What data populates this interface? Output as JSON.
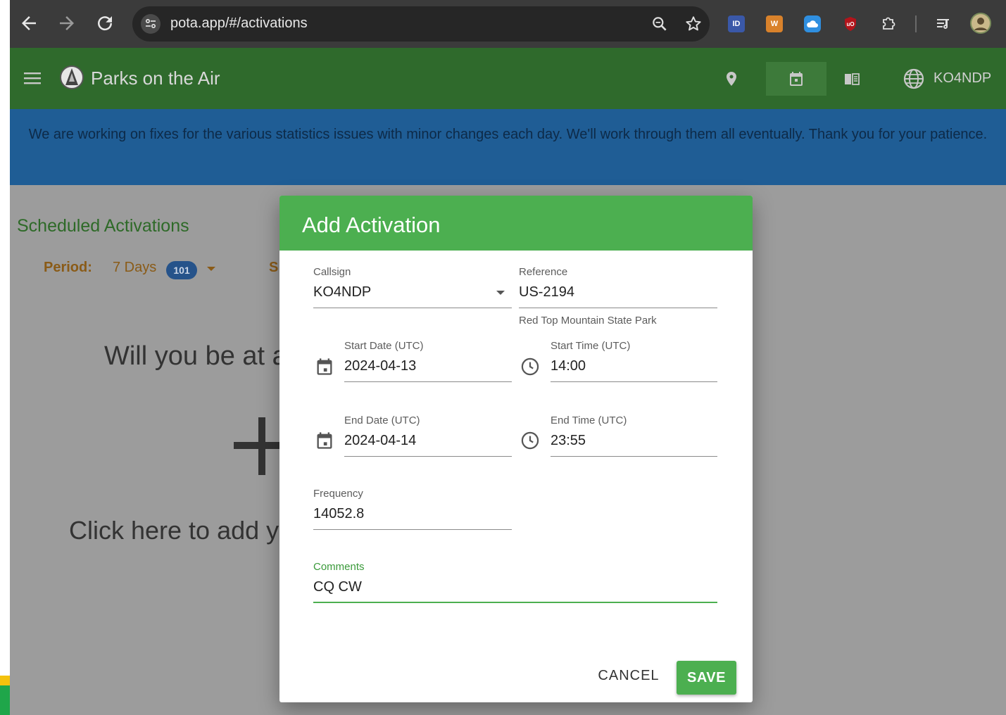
{
  "browser": {
    "url": "pota.app/#/activations"
  },
  "app": {
    "title": "Parks on the Air",
    "user": "KO4NDP"
  },
  "banner": {
    "text": "We are working on fixes for the various statistics issues with minor changes each day. We'll work through them all eventually. Thank you for your patience."
  },
  "page": {
    "section_title": "Scheduled Activations",
    "period_label": "Period:",
    "period_value": "7 Days",
    "period_count": "101",
    "partial_filter_letter": "S",
    "prompt_partial": "Will you be at a",
    "add_prompt_partial": "Click here to add y"
  },
  "dialog": {
    "title": "Add Activation",
    "callsign": {
      "label": "Callsign",
      "value": "KO4NDP"
    },
    "reference": {
      "label": "Reference",
      "value": "US-2194",
      "hint": "Red Top Mountain State Park"
    },
    "start_date": {
      "label": "Start Date (UTC)",
      "value": "2024-04-13"
    },
    "start_time": {
      "label": "Start Time (UTC)",
      "value": "14:00"
    },
    "end_date": {
      "label": "End Date (UTC)",
      "value": "2024-04-14"
    },
    "end_time": {
      "label": "End Time (UTC)",
      "value": "23:55"
    },
    "frequency": {
      "label": "Frequency",
      "value": "14052.8"
    },
    "comments": {
      "label": "Comments",
      "value": "CQ CW"
    },
    "cancel_label": "CANCEL",
    "save_label": "SAVE"
  },
  "colors": {
    "appbar": "#2f6a2c",
    "banner": "#1f5d95",
    "dialog_header": "#4caf50",
    "save_button": "#4caf50",
    "focus_line": "#4caf50"
  },
  "icons": {
    "nav": [
      "back-arrow-icon",
      "forward-arrow-icon",
      "reload-icon"
    ],
    "url": [
      "site-settings-icon",
      "zoom-icon",
      "bookmark-star-icon"
    ],
    "extensions": [
      "ext-icon-1",
      "ext-icon-2",
      "icloud-icon",
      "ublock-icon",
      "puzzle-icon",
      "reading-list-icon",
      "profile-avatar-icon"
    ],
    "appbar": [
      "menu-icon",
      "pota-logo-icon",
      "map-pin-icon",
      "calendar-icon",
      "book-icon",
      "globe-icon"
    ],
    "dialog": [
      "calendar-icon",
      "clock-icon"
    ]
  }
}
